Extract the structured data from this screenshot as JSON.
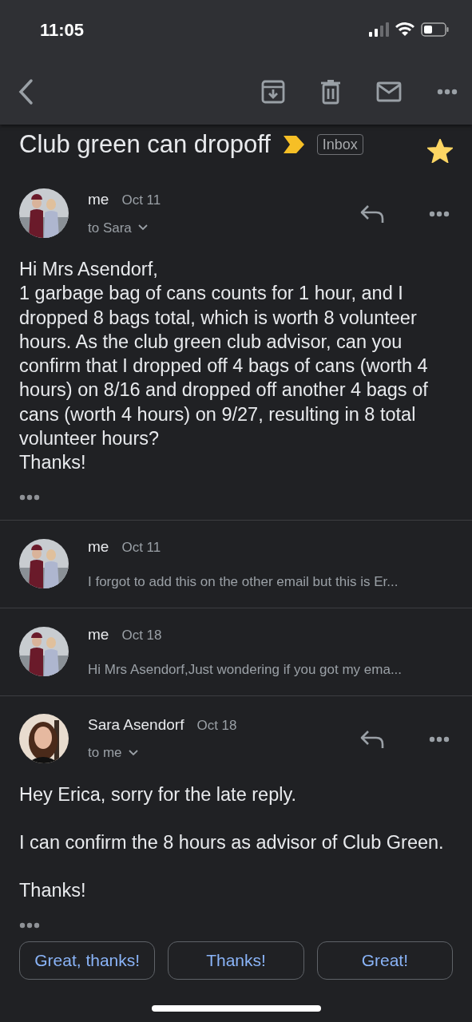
{
  "status_bar": {
    "time": "11:05"
  },
  "toolbar": {
    "actions": [
      {
        "kind": "back"
      },
      {
        "kind": "archive"
      },
      {
        "kind": "delete"
      },
      {
        "kind": "mail"
      },
      {
        "kind": "more"
      }
    ]
  },
  "subject": {
    "title": "Club green can dropoff",
    "important": true,
    "label": "Inbox",
    "starred": true
  },
  "messages": [
    {
      "kind": "expanded",
      "sender": "me",
      "date": "Oct 11",
      "recipient": "to Sara",
      "avatar": {
        "kind": "pair"
      },
      "paragraphs": [
        "Hi Mrs Asendorf,\n1 garbage bag of cans counts for 1 hour, and I dropped 8 bags total, which is worth 8 volunteer hours. As the club green club advisor, can you confirm that I dropped off 4 bags of cans (worth 4 hours) on 8/16 and dropped off another 4 bags of cans (worth 4 hours) on 9/27, resulting in 8 total volunteer hours?\nThanks!"
      ]
    },
    {
      "kind": "collapsed",
      "sender": "me",
      "date": "Oct 11",
      "snippet": "I forgot to add this on the other email but this is Er...",
      "avatar": {
        "kind": "pair"
      }
    },
    {
      "kind": "collapsed",
      "sender": "me",
      "date": "Oct 18",
      "snippet": "Hi Mrs Asendorf,Just wondering if you got my ema...",
      "avatar": {
        "kind": "pair"
      }
    },
    {
      "kind": "expanded",
      "sender": "Sara Asendorf",
      "date": "Oct 18",
      "recipient": "to me",
      "avatar": {
        "kind": "single"
      },
      "paragraphs": [
        "Hey Erica, sorry for the late reply.",
        "I can confirm the 8 hours as advisor of Club Green.",
        "Thanks!"
      ]
    }
  ],
  "smart_replies": [
    "Great, thanks!",
    "Thanks!",
    "Great!"
  ]
}
